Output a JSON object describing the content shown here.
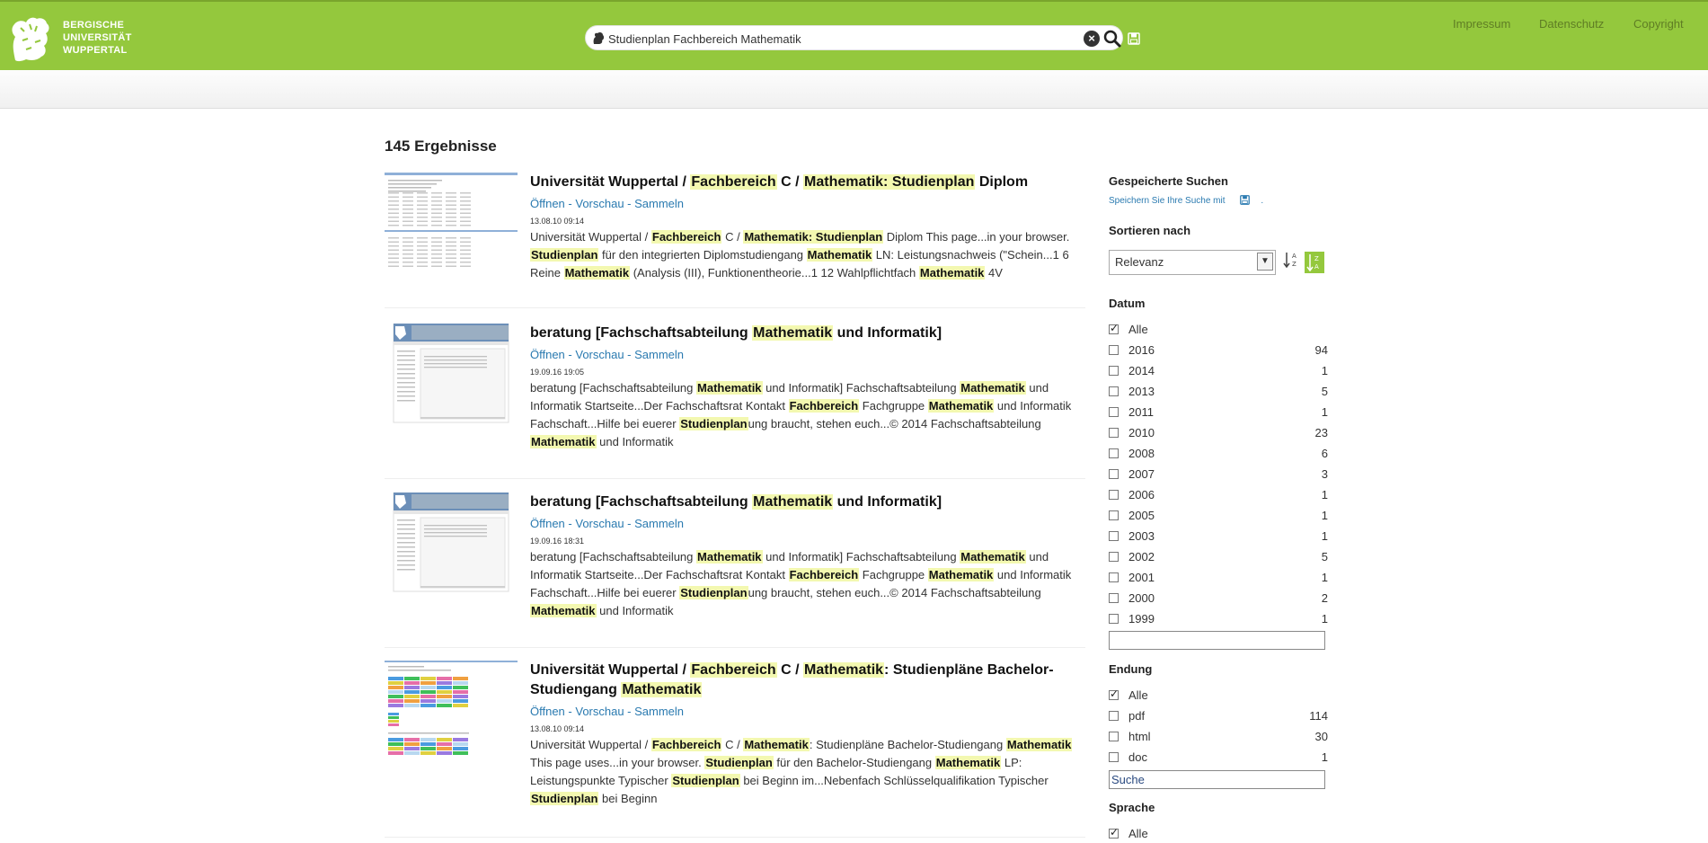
{
  "header": {
    "logo_lines": [
      "BERGISCHE",
      "UNIVERSITÄT",
      "WUPPERTAL"
    ],
    "search_value": "Studienplan Fachbereich Mathematik",
    "nav": [
      "Impressum",
      "Datenschutz",
      "Copyright"
    ]
  },
  "results_count": "145 Ergebnisse",
  "results": [
    {
      "title_parts": [
        {
          "t": "Universität Wuppertal / "
        },
        {
          "t": "Fachbereich",
          "h": true
        },
        {
          "t": " C / "
        },
        {
          "t": "Mathematik: Studienplan",
          "h": true
        },
        {
          "t": " Diplom"
        }
      ],
      "actions": [
        "Öffnen",
        "Vorschau",
        "Sammeln"
      ],
      "date": "13.08.10 09:14",
      "snippet_parts": [
        {
          "t": "Universität Wuppertal / "
        },
        {
          "t": "Fachbereich",
          "h": true
        },
        {
          "t": " C / "
        },
        {
          "t": "Mathematik: Studienplan",
          "h": true
        },
        {
          "t": " Diplom This page...in your browser. "
        },
        {
          "t": "Studienplan",
          "h": true
        },
        {
          "t": " für den integrierten Diplomstudiengang "
        },
        {
          "t": "Mathematik",
          "h": true
        },
        {
          "t": " LN: Leistungsnachweis (\"Schein...1 6 Reine "
        },
        {
          "t": "Mathematik",
          "h": true
        },
        {
          "t": " (Analysis (III), Funktionentheorie...1 12 Wahlpflichtfach "
        },
        {
          "t": "Mathematik",
          "h": true
        },
        {
          "t": " 4V"
        }
      ]
    },
    {
      "title_parts": [
        {
          "t": "beratung [Fachschaftsabteilung "
        },
        {
          "t": "Mathematik",
          "h": true
        },
        {
          "t": " und Informatik]"
        }
      ],
      "actions": [
        "Öffnen",
        "Vorschau",
        "Sammeln"
      ],
      "date": "19.09.16 19:05",
      "snippet_parts": [
        {
          "t": "beratung [Fachschaftsabteilung "
        },
        {
          "t": "Mathematik",
          "h": true
        },
        {
          "t": " und Informatik] Fachschaftsabteilung "
        },
        {
          "t": "Mathematik",
          "h": true
        },
        {
          "t": " und Informatik Startseite...Der Fachschaftsrat Kontakt "
        },
        {
          "t": "Fachbereich",
          "h": true
        },
        {
          "t": " Fachgruppe "
        },
        {
          "t": "Mathematik",
          "h": true
        },
        {
          "t": " und Informatik Fachschaft...Hilfe bei euerer "
        },
        {
          "t": "Studienplan",
          "h": true
        },
        {
          "t": "ung braucht, stehen euch...© 2014 Fachschaftsabteilung "
        },
        {
          "t": "Mathematik",
          "h": true
        },
        {
          "t": " und Informatik"
        }
      ]
    },
    {
      "title_parts": [
        {
          "t": "beratung [Fachschaftsabteilung "
        },
        {
          "t": "Mathematik",
          "h": true
        },
        {
          "t": " und Informatik]"
        }
      ],
      "actions": [
        "Öffnen",
        "Vorschau",
        "Sammeln"
      ],
      "date": "19.09.16 18:31",
      "snippet_parts": [
        {
          "t": "beratung [Fachschaftsabteilung "
        },
        {
          "t": "Mathematik",
          "h": true
        },
        {
          "t": " und Informatik] Fachschaftsabteilung "
        },
        {
          "t": "Mathematik",
          "h": true
        },
        {
          "t": " und Informatik Startseite...Der Fachschaftsrat Kontakt "
        },
        {
          "t": "Fachbereich",
          "h": true
        },
        {
          "t": " Fachgruppe "
        },
        {
          "t": "Mathematik",
          "h": true
        },
        {
          "t": " und Informatik Fachschaft...Hilfe bei euerer "
        },
        {
          "t": "Studienplan",
          "h": true
        },
        {
          "t": "ung braucht, stehen euch...© 2014 Fachschaftsabteilung "
        },
        {
          "t": "Mathematik",
          "h": true
        },
        {
          "t": " und Informatik"
        }
      ]
    },
    {
      "title_parts": [
        {
          "t": "Universität Wuppertal / "
        },
        {
          "t": "Fachbereich",
          "h": true
        },
        {
          "t": " C / "
        },
        {
          "t": "Mathematik",
          "h": true
        },
        {
          "t": ": Studienpläne Bachelor-Studiengang "
        },
        {
          "t": "Mathematik",
          "h": true
        }
      ],
      "actions": [
        "Öffnen",
        "Vorschau",
        "Sammeln"
      ],
      "date": "13.08.10 09:14",
      "snippet_parts": [
        {
          "t": "Universität Wuppertal / "
        },
        {
          "t": "Fachbereich",
          "h": true
        },
        {
          "t": " C / "
        },
        {
          "t": "Mathematik",
          "h": true
        },
        {
          "t": ": Studienpläne Bachelor-Studiengang "
        },
        {
          "t": "Mathematik",
          "h": true
        },
        {
          "t": " This page uses...in your browser. "
        },
        {
          "t": "Studienplan",
          "h": true
        },
        {
          "t": " für den Bachelor-Studiengang "
        },
        {
          "t": "Mathematik",
          "h": true
        },
        {
          "t": " LP: Leistungspunkte Typischer "
        },
        {
          "t": "Studienplan",
          "h": true
        },
        {
          "t": " bei Beginn im...Nebenfach Schlüsselqualifikation Typischer "
        },
        {
          "t": "Studienplan",
          "h": true
        },
        {
          "t": " bei Beginn"
        }
      ]
    }
  ],
  "sidebar": {
    "saved_title": "Gespeicherte Suchen",
    "saved_link": "Speichern Sie Ihre Suche mit",
    "saved_dot": ".",
    "sort_title": "Sortieren nach",
    "sort_value": "Relevanz",
    "date_title": "Datum",
    "date_items": [
      {
        "label": "Alle",
        "count": "",
        "checked": true
      },
      {
        "label": "2016",
        "count": "94"
      },
      {
        "label": "2014",
        "count": "1"
      },
      {
        "label": "2013",
        "count": "5"
      },
      {
        "label": "2011",
        "count": "1"
      },
      {
        "label": "2010",
        "count": "23"
      },
      {
        "label": "2008",
        "count": "6"
      },
      {
        "label": "2007",
        "count": "3"
      },
      {
        "label": "2006",
        "count": "1"
      },
      {
        "label": "2005",
        "count": "1"
      },
      {
        "label": "2003",
        "count": "1"
      },
      {
        "label": "2002",
        "count": "5"
      },
      {
        "label": "2001",
        "count": "1"
      },
      {
        "label": "2000",
        "count": "2"
      },
      {
        "label": "1999",
        "count": "1"
      }
    ],
    "date_filter_value": "",
    "ext_title": "Endung",
    "ext_items": [
      {
        "label": "Alle",
        "count": "",
        "checked": true
      },
      {
        "label": "pdf",
        "count": "114"
      },
      {
        "label": "html",
        "count": "30"
      },
      {
        "label": "doc",
        "count": "1"
      }
    ],
    "ext_filter_placeholder": "Suche",
    "lang_title": "Sprache",
    "lang_items": [
      {
        "label": "Alle",
        "count": "",
        "checked": true
      }
    ]
  },
  "colors": {
    "brand_green": "#94c83d",
    "link_blue": "#2a7ab0",
    "highlight": "#f3f8b0"
  }
}
